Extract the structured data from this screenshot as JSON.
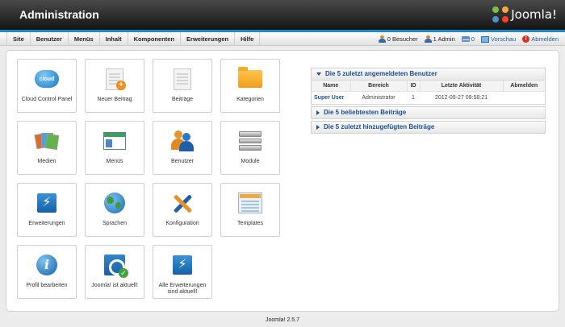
{
  "header": {
    "title": "Administration",
    "logo_text": "Joomla!"
  },
  "menu": [
    "Site",
    "Benutzer",
    "Menüs",
    "Inhalt",
    "Komponenten",
    "Erweiterungen",
    "Hilfe"
  ],
  "status": {
    "visitors": "0 Besucher",
    "admins": "1 Admin",
    "messages": "0",
    "preview": "Vorschau",
    "logout": "Abmelden"
  },
  "tiles": {
    "cloud_badge": "cloud",
    "cloud": "Cloud Control Panel",
    "new_article": "Neuer Beitrag",
    "articles": "Beiträge",
    "categories": "Kategorien",
    "media": "Medien",
    "menus": "Menüs",
    "users": "Benutzer",
    "modules": "Module",
    "extensions": "Erweiterungen",
    "languages": "Sprachen",
    "configuration": "Konfiguration",
    "templates": "Templates",
    "profile": "Profil bearbeiten",
    "joomla_uptodate": "Joomla! ist aktuell!",
    "extensions_uptodate": "Alle Erweiterungen sind aktuell!"
  },
  "modules": {
    "logged_in": {
      "title": "Die 5 zuletzt angemeldeten Benutzer",
      "columns": [
        "Name",
        "Bereich",
        "ID",
        "Letzte Aktivität",
        "Abmelden"
      ],
      "rows": [
        {
          "name": "Super User",
          "area": "Administrator",
          "id": "1",
          "last_activity": "2012-09-27 09:58:21",
          "logout": ""
        }
      ]
    },
    "popular": {
      "title": "Die 5 beliebtesten Beiträge"
    },
    "latest": {
      "title": "Die 5 zuletzt hinzugefügten Beiträge"
    }
  },
  "footer": {
    "version": "Joomla! 2.5.7"
  },
  "colors": {
    "accent": "#1b8cc6",
    "link": "#1a4f8b",
    "header_bg": "#141414"
  }
}
